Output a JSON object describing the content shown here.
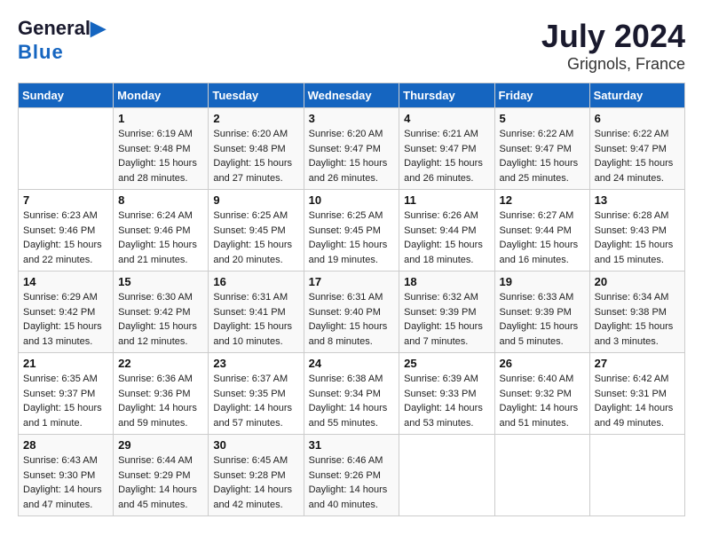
{
  "header": {
    "logo_line1": "General",
    "logo_line2": "Blue",
    "title": "July 2024",
    "subtitle": "Grignols, France"
  },
  "calendar": {
    "days_of_week": [
      "Sunday",
      "Monday",
      "Tuesday",
      "Wednesday",
      "Thursday",
      "Friday",
      "Saturday"
    ],
    "weeks": [
      [
        {
          "day": "",
          "info": ""
        },
        {
          "day": "1",
          "info": "Sunrise: 6:19 AM\nSunset: 9:48 PM\nDaylight: 15 hours\nand 28 minutes."
        },
        {
          "day": "2",
          "info": "Sunrise: 6:20 AM\nSunset: 9:48 PM\nDaylight: 15 hours\nand 27 minutes."
        },
        {
          "day": "3",
          "info": "Sunrise: 6:20 AM\nSunset: 9:47 PM\nDaylight: 15 hours\nand 26 minutes."
        },
        {
          "day": "4",
          "info": "Sunrise: 6:21 AM\nSunset: 9:47 PM\nDaylight: 15 hours\nand 26 minutes."
        },
        {
          "day": "5",
          "info": "Sunrise: 6:22 AM\nSunset: 9:47 PM\nDaylight: 15 hours\nand 25 minutes."
        },
        {
          "day": "6",
          "info": "Sunrise: 6:22 AM\nSunset: 9:47 PM\nDaylight: 15 hours\nand 24 minutes."
        }
      ],
      [
        {
          "day": "7",
          "info": "Sunrise: 6:23 AM\nSunset: 9:46 PM\nDaylight: 15 hours\nand 22 minutes."
        },
        {
          "day": "8",
          "info": "Sunrise: 6:24 AM\nSunset: 9:46 PM\nDaylight: 15 hours\nand 21 minutes."
        },
        {
          "day": "9",
          "info": "Sunrise: 6:25 AM\nSunset: 9:45 PM\nDaylight: 15 hours\nand 20 minutes."
        },
        {
          "day": "10",
          "info": "Sunrise: 6:25 AM\nSunset: 9:45 PM\nDaylight: 15 hours\nand 19 minutes."
        },
        {
          "day": "11",
          "info": "Sunrise: 6:26 AM\nSunset: 9:44 PM\nDaylight: 15 hours\nand 18 minutes."
        },
        {
          "day": "12",
          "info": "Sunrise: 6:27 AM\nSunset: 9:44 PM\nDaylight: 15 hours\nand 16 minutes."
        },
        {
          "day": "13",
          "info": "Sunrise: 6:28 AM\nSunset: 9:43 PM\nDaylight: 15 hours\nand 15 minutes."
        }
      ],
      [
        {
          "day": "14",
          "info": "Sunrise: 6:29 AM\nSunset: 9:42 PM\nDaylight: 15 hours\nand 13 minutes."
        },
        {
          "day": "15",
          "info": "Sunrise: 6:30 AM\nSunset: 9:42 PM\nDaylight: 15 hours\nand 12 minutes."
        },
        {
          "day": "16",
          "info": "Sunrise: 6:31 AM\nSunset: 9:41 PM\nDaylight: 15 hours\nand 10 minutes."
        },
        {
          "day": "17",
          "info": "Sunrise: 6:31 AM\nSunset: 9:40 PM\nDaylight: 15 hours\nand 8 minutes."
        },
        {
          "day": "18",
          "info": "Sunrise: 6:32 AM\nSunset: 9:39 PM\nDaylight: 15 hours\nand 7 minutes."
        },
        {
          "day": "19",
          "info": "Sunrise: 6:33 AM\nSunset: 9:39 PM\nDaylight: 15 hours\nand 5 minutes."
        },
        {
          "day": "20",
          "info": "Sunrise: 6:34 AM\nSunset: 9:38 PM\nDaylight: 15 hours\nand 3 minutes."
        }
      ],
      [
        {
          "day": "21",
          "info": "Sunrise: 6:35 AM\nSunset: 9:37 PM\nDaylight: 15 hours\nand 1 minute."
        },
        {
          "day": "22",
          "info": "Sunrise: 6:36 AM\nSunset: 9:36 PM\nDaylight: 14 hours\nand 59 minutes."
        },
        {
          "day": "23",
          "info": "Sunrise: 6:37 AM\nSunset: 9:35 PM\nDaylight: 14 hours\nand 57 minutes."
        },
        {
          "day": "24",
          "info": "Sunrise: 6:38 AM\nSunset: 9:34 PM\nDaylight: 14 hours\nand 55 minutes."
        },
        {
          "day": "25",
          "info": "Sunrise: 6:39 AM\nSunset: 9:33 PM\nDaylight: 14 hours\nand 53 minutes."
        },
        {
          "day": "26",
          "info": "Sunrise: 6:40 AM\nSunset: 9:32 PM\nDaylight: 14 hours\nand 51 minutes."
        },
        {
          "day": "27",
          "info": "Sunrise: 6:42 AM\nSunset: 9:31 PM\nDaylight: 14 hours\nand 49 minutes."
        }
      ],
      [
        {
          "day": "28",
          "info": "Sunrise: 6:43 AM\nSunset: 9:30 PM\nDaylight: 14 hours\nand 47 minutes."
        },
        {
          "day": "29",
          "info": "Sunrise: 6:44 AM\nSunset: 9:29 PM\nDaylight: 14 hours\nand 45 minutes."
        },
        {
          "day": "30",
          "info": "Sunrise: 6:45 AM\nSunset: 9:28 PM\nDaylight: 14 hours\nand 42 minutes."
        },
        {
          "day": "31",
          "info": "Sunrise: 6:46 AM\nSunset: 9:26 PM\nDaylight: 14 hours\nand 40 minutes."
        },
        {
          "day": "",
          "info": ""
        },
        {
          "day": "",
          "info": ""
        },
        {
          "day": "",
          "info": ""
        }
      ]
    ]
  }
}
